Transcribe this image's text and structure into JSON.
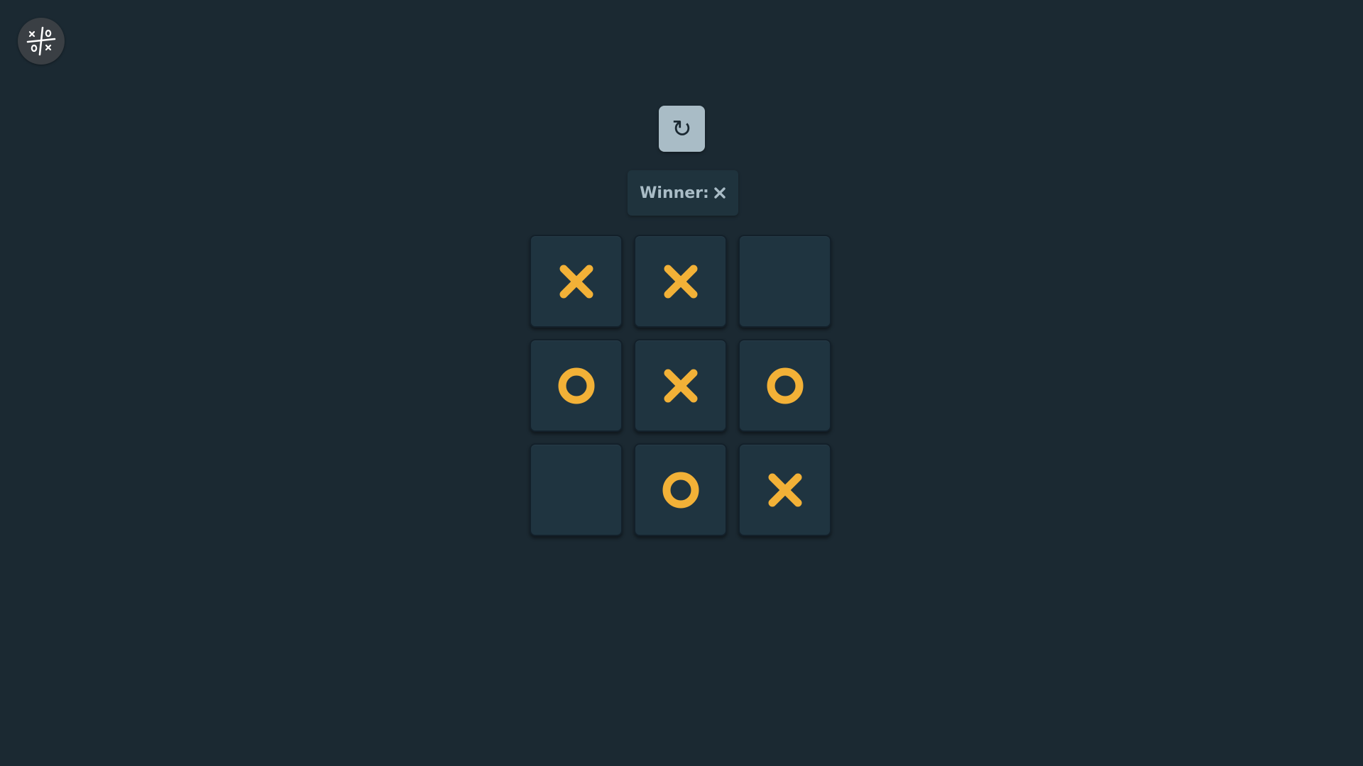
{
  "logo_icon": "tic-tac-toe-logo-icon",
  "reset_icon": "↻",
  "status": {
    "label": "Winner:",
    "winner": "X"
  },
  "board": [
    "X",
    "X",
    "",
    "O",
    "X",
    "O",
    "",
    "O",
    "X"
  ],
  "colors": {
    "background": "#1b2932",
    "cell": "#1f3440",
    "mark": "#f2b137",
    "reset_button": "#a9bcc6",
    "status_text": "#a9bcc6"
  }
}
